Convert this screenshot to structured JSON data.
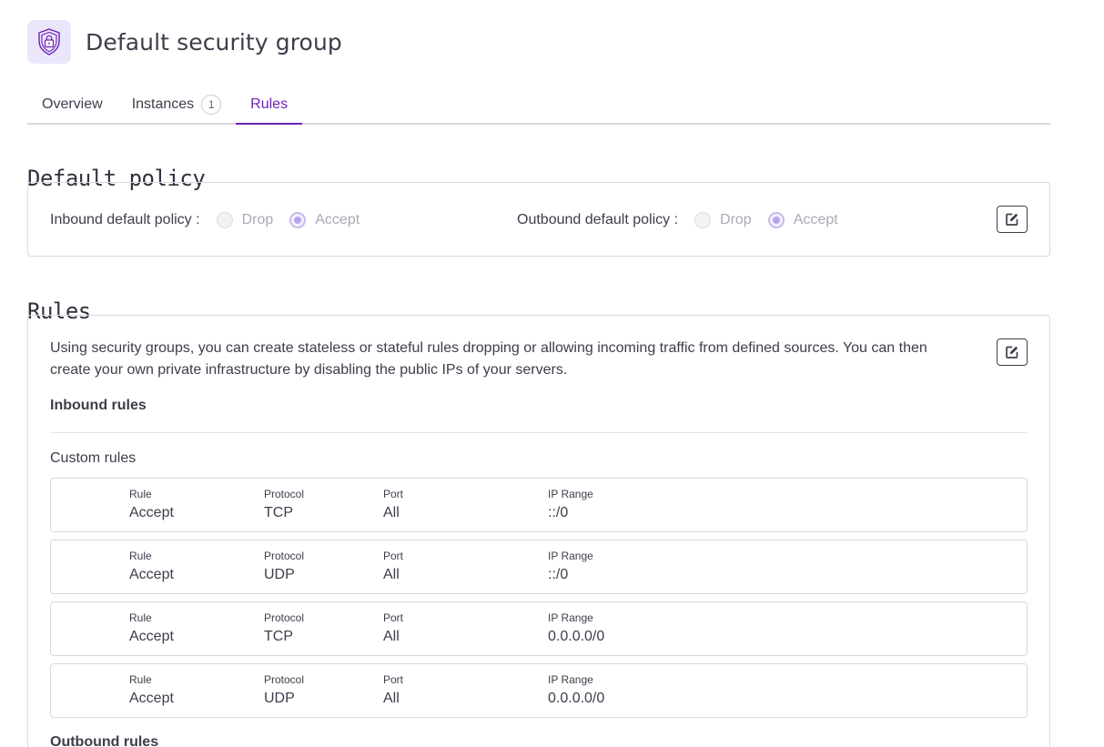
{
  "header": {
    "title": "Default security group",
    "icon": "shield-lock-icon",
    "accent": "#6d23b8"
  },
  "tabs": [
    {
      "label": "Overview",
      "active": false
    },
    {
      "label": "Instances",
      "badge": "1",
      "active": false
    },
    {
      "label": "Rules",
      "active": true
    }
  ],
  "default_policy": {
    "title": "Default policy",
    "inbound": {
      "label": "Inbound default policy :",
      "options": [
        "Drop",
        "Accept"
      ],
      "selected": "Accept"
    },
    "outbound": {
      "label": "Outbound default policy :",
      "options": [
        "Drop",
        "Accept"
      ],
      "selected": "Accept"
    },
    "edit_icon": "edit-icon"
  },
  "rules": {
    "title": "Rules",
    "description": "Using security groups, you can create stateless or stateful rules dropping or allowing incoming traffic from defined sources. You can then create your own private infrastructure by disabling the public IPs of your servers.",
    "inbound_heading": "Inbound rules",
    "custom_heading": "Custom rules",
    "outbound_heading": "Outbound rules",
    "columns": {
      "rule": "Rule",
      "protocol": "Protocol",
      "port": "Port",
      "ip_range": "IP Range"
    },
    "rows": [
      {
        "rule": "Accept",
        "protocol": "TCP",
        "port": "All",
        "ip_range": "::/0"
      },
      {
        "rule": "Accept",
        "protocol": "UDP",
        "port": "All",
        "ip_range": "::/0"
      },
      {
        "rule": "Accept",
        "protocol": "TCP",
        "port": "All",
        "ip_range": "0.0.0.0/0"
      },
      {
        "rule": "Accept",
        "protocol": "UDP",
        "port": "All",
        "ip_range": "0.0.0.0/0"
      }
    ]
  }
}
